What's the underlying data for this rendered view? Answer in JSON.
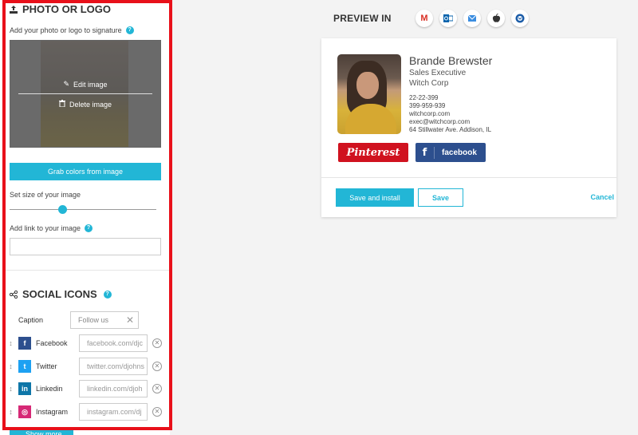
{
  "photo_section": {
    "title": "PHOTO OR LOGO",
    "add_label": "Add your photo or logo to signature",
    "edit_label": "Edit image",
    "delete_label": "Delete image",
    "grab_colors_label": "Grab colors from image",
    "size_label": "Set size of your image",
    "size_slider_fraction": 0.36,
    "link_label": "Add link to your image",
    "link_value": ""
  },
  "social_section": {
    "title": "SOCIAL ICONS",
    "caption_label": "Caption",
    "caption_placeholder": "Follow us",
    "items": [
      {
        "name": "Facebook",
        "placeholder": "facebook.com/djc",
        "icon": "facebook-icon",
        "color": "#2d4f8e",
        "glyph": "f"
      },
      {
        "name": "Twitter",
        "placeholder": "twitter.com/djohns",
        "icon": "twitter-icon",
        "color": "#1da1f2",
        "glyph": "t"
      },
      {
        "name": "Linkedin",
        "placeholder": "linkedin.com/djoh",
        "icon": "linkedin-icon",
        "color": "#0e76a8",
        "glyph": "in"
      },
      {
        "name": "Instagram",
        "placeholder": "instagram.com/dj",
        "icon": "instagram-icon",
        "color": "#d62976",
        "glyph": "◎"
      }
    ],
    "show_more_label": "Show more"
  },
  "preview": {
    "title": "PREVIEW IN",
    "clients": [
      "gmail-icon",
      "outlook-icon",
      "apple-mail-icon",
      "apple-icon",
      "thunderbird-icon"
    ]
  },
  "signature": {
    "name": "Brande Brewster",
    "role": "Sales Executive",
    "company": "Witch Corp",
    "phone1": "22-22-399",
    "phone2": "399-959-939",
    "website": "witchcorp.com",
    "email": "exec@witchcorp.com",
    "address": "64 Stillwater Ave. Addison, IL",
    "pinterest_label": "Pinterest",
    "facebook_label": "facebook"
  },
  "actions": {
    "install_label": "Save and install",
    "save_label": "Save",
    "cancel_label": "Cancel"
  },
  "colors": {
    "accent": "#22b6d6",
    "highlight": "#e8101a",
    "pinterest": "#d0121f",
    "facebook": "#2d4f8e"
  }
}
